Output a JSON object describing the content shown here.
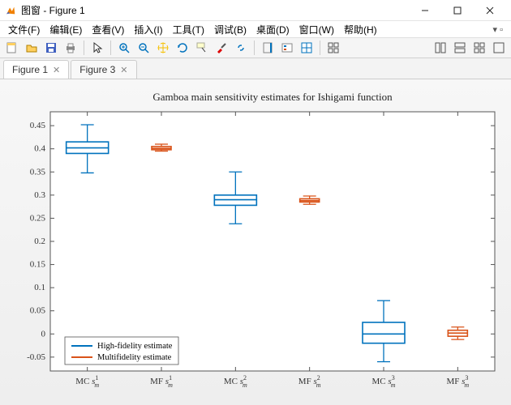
{
  "window": {
    "title": "图窗 - Figure 1"
  },
  "menu": {
    "file": "文件(F)",
    "edit": "编辑(E)",
    "view": "查看(V)",
    "insert": "插入(I)",
    "tools": "工具(T)",
    "debug": "调试(B)",
    "desktop": "桌面(D)",
    "window": "窗口(W)",
    "help": "帮助(H)"
  },
  "tabs": {
    "tab1": "Figure 1",
    "tab2": "Figure 3"
  },
  "legend": {
    "hf": "High-fidelity estimate",
    "mf": "Multifidelity estimate"
  },
  "chart_data": {
    "type": "boxplot",
    "title": "Gamboa main sensitivity estimates for Ishigami function",
    "ylabel": "",
    "xlabel": "",
    "ylim": [
      -0.08,
      0.48
    ],
    "yticks": [
      -0.05,
      0,
      0.05,
      0.1,
      0.15,
      0.2,
      0.25,
      0.3,
      0.35,
      0.4,
      0.45
    ],
    "categories": [
      "MC s_m^1",
      "MF s_m^1",
      "MC s_m^2",
      "MF s_m^2",
      "MC s_m^3",
      "MF s_m^3"
    ],
    "colors": {
      "hf": "#0072BD",
      "mf": "#D95319"
    },
    "group": [
      "hf",
      "mf",
      "hf",
      "mf",
      "hf",
      "mf"
    ],
    "boxes": [
      {
        "min": 0.348,
        "q1": 0.39,
        "median": 0.402,
        "q3": 0.415,
        "max": 0.452
      },
      {
        "min": 0.395,
        "q1": 0.398,
        "median": 0.401,
        "q3": 0.405,
        "max": 0.41
      },
      {
        "min": 0.238,
        "q1": 0.278,
        "median": 0.29,
        "q3": 0.3,
        "max": 0.35
      },
      {
        "min": 0.28,
        "q1": 0.285,
        "median": 0.288,
        "q3": 0.292,
        "max": 0.298
      },
      {
        "min": -0.06,
        "q1": -0.02,
        "median": 0.0,
        "q3": 0.025,
        "max": 0.072
      },
      {
        "min": -0.012,
        "q1": -0.005,
        "median": 0.002,
        "q3": 0.008,
        "max": 0.015
      }
    ]
  }
}
